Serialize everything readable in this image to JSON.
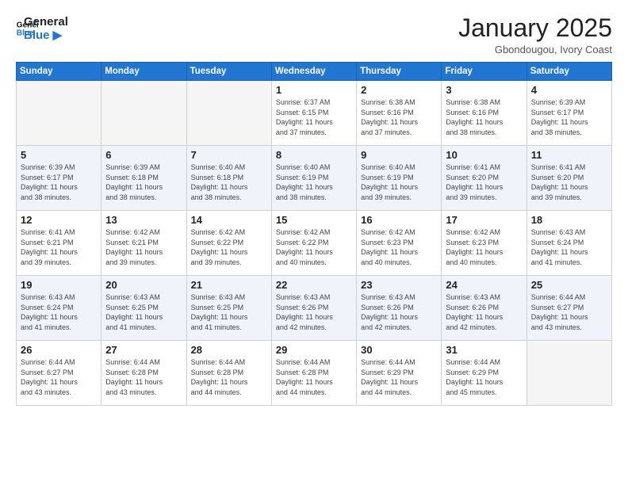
{
  "header": {
    "logo_line1": "General",
    "logo_line2": "Blue",
    "title": "January 2025",
    "subtitle": "Gbondougou, Ivory Coast"
  },
  "weekdays": [
    "Sunday",
    "Monday",
    "Tuesday",
    "Wednesday",
    "Thursday",
    "Friday",
    "Saturday"
  ],
  "weeks": [
    [
      {
        "day": "",
        "info": ""
      },
      {
        "day": "",
        "info": ""
      },
      {
        "day": "",
        "info": ""
      },
      {
        "day": "1",
        "info": "Sunrise: 6:37 AM\nSunset: 6:15 PM\nDaylight: 11 hours\nand 37 minutes."
      },
      {
        "day": "2",
        "info": "Sunrise: 6:38 AM\nSunset: 6:16 PM\nDaylight: 11 hours\nand 37 minutes."
      },
      {
        "day": "3",
        "info": "Sunrise: 6:38 AM\nSunset: 6:16 PM\nDaylight: 11 hours\nand 38 minutes."
      },
      {
        "day": "4",
        "info": "Sunrise: 6:39 AM\nSunset: 6:17 PM\nDaylight: 11 hours\nand 38 minutes."
      }
    ],
    [
      {
        "day": "5",
        "info": "Sunrise: 6:39 AM\nSunset: 6:17 PM\nDaylight: 11 hours\nand 38 minutes."
      },
      {
        "day": "6",
        "info": "Sunrise: 6:39 AM\nSunset: 6:18 PM\nDaylight: 11 hours\nand 38 minutes."
      },
      {
        "day": "7",
        "info": "Sunrise: 6:40 AM\nSunset: 6:18 PM\nDaylight: 11 hours\nand 38 minutes."
      },
      {
        "day": "8",
        "info": "Sunrise: 6:40 AM\nSunset: 6:19 PM\nDaylight: 11 hours\nand 38 minutes."
      },
      {
        "day": "9",
        "info": "Sunrise: 6:40 AM\nSunset: 6:19 PM\nDaylight: 11 hours\nand 39 minutes."
      },
      {
        "day": "10",
        "info": "Sunrise: 6:41 AM\nSunset: 6:20 PM\nDaylight: 11 hours\nand 39 minutes."
      },
      {
        "day": "11",
        "info": "Sunrise: 6:41 AM\nSunset: 6:20 PM\nDaylight: 11 hours\nand 39 minutes."
      }
    ],
    [
      {
        "day": "12",
        "info": "Sunrise: 6:41 AM\nSunset: 6:21 PM\nDaylight: 11 hours\nand 39 minutes."
      },
      {
        "day": "13",
        "info": "Sunrise: 6:42 AM\nSunset: 6:21 PM\nDaylight: 11 hours\nand 39 minutes."
      },
      {
        "day": "14",
        "info": "Sunrise: 6:42 AM\nSunset: 6:22 PM\nDaylight: 11 hours\nand 39 minutes."
      },
      {
        "day": "15",
        "info": "Sunrise: 6:42 AM\nSunset: 6:22 PM\nDaylight: 11 hours\nand 40 minutes."
      },
      {
        "day": "16",
        "info": "Sunrise: 6:42 AM\nSunset: 6:23 PM\nDaylight: 11 hours\nand 40 minutes."
      },
      {
        "day": "17",
        "info": "Sunrise: 6:42 AM\nSunset: 6:23 PM\nDaylight: 11 hours\nand 40 minutes."
      },
      {
        "day": "18",
        "info": "Sunrise: 6:43 AM\nSunset: 6:24 PM\nDaylight: 11 hours\nand 41 minutes."
      }
    ],
    [
      {
        "day": "19",
        "info": "Sunrise: 6:43 AM\nSunset: 6:24 PM\nDaylight: 11 hours\nand 41 minutes."
      },
      {
        "day": "20",
        "info": "Sunrise: 6:43 AM\nSunset: 6:25 PM\nDaylight: 11 hours\nand 41 minutes."
      },
      {
        "day": "21",
        "info": "Sunrise: 6:43 AM\nSunset: 6:25 PM\nDaylight: 11 hours\nand 41 minutes."
      },
      {
        "day": "22",
        "info": "Sunrise: 6:43 AM\nSunset: 6:26 PM\nDaylight: 11 hours\nand 42 minutes."
      },
      {
        "day": "23",
        "info": "Sunrise: 6:43 AM\nSunset: 6:26 PM\nDaylight: 11 hours\nand 42 minutes."
      },
      {
        "day": "24",
        "info": "Sunrise: 6:43 AM\nSunset: 6:26 PM\nDaylight: 11 hours\nand 42 minutes."
      },
      {
        "day": "25",
        "info": "Sunrise: 6:44 AM\nSunset: 6:27 PM\nDaylight: 11 hours\nand 43 minutes."
      }
    ],
    [
      {
        "day": "26",
        "info": "Sunrise: 6:44 AM\nSunset: 6:27 PM\nDaylight: 11 hours\nand 43 minutes."
      },
      {
        "day": "27",
        "info": "Sunrise: 6:44 AM\nSunset: 6:28 PM\nDaylight: 11 hours\nand 43 minutes."
      },
      {
        "day": "28",
        "info": "Sunrise: 6:44 AM\nSunset: 6:28 PM\nDaylight: 11 hours\nand 44 minutes."
      },
      {
        "day": "29",
        "info": "Sunrise: 6:44 AM\nSunset: 6:28 PM\nDaylight: 11 hours\nand 44 minutes."
      },
      {
        "day": "30",
        "info": "Sunrise: 6:44 AM\nSunset: 6:29 PM\nDaylight: 11 hours\nand 44 minutes."
      },
      {
        "day": "31",
        "info": "Sunrise: 6:44 AM\nSunset: 6:29 PM\nDaylight: 11 hours\nand 45 minutes."
      },
      {
        "day": "",
        "info": ""
      }
    ]
  ]
}
